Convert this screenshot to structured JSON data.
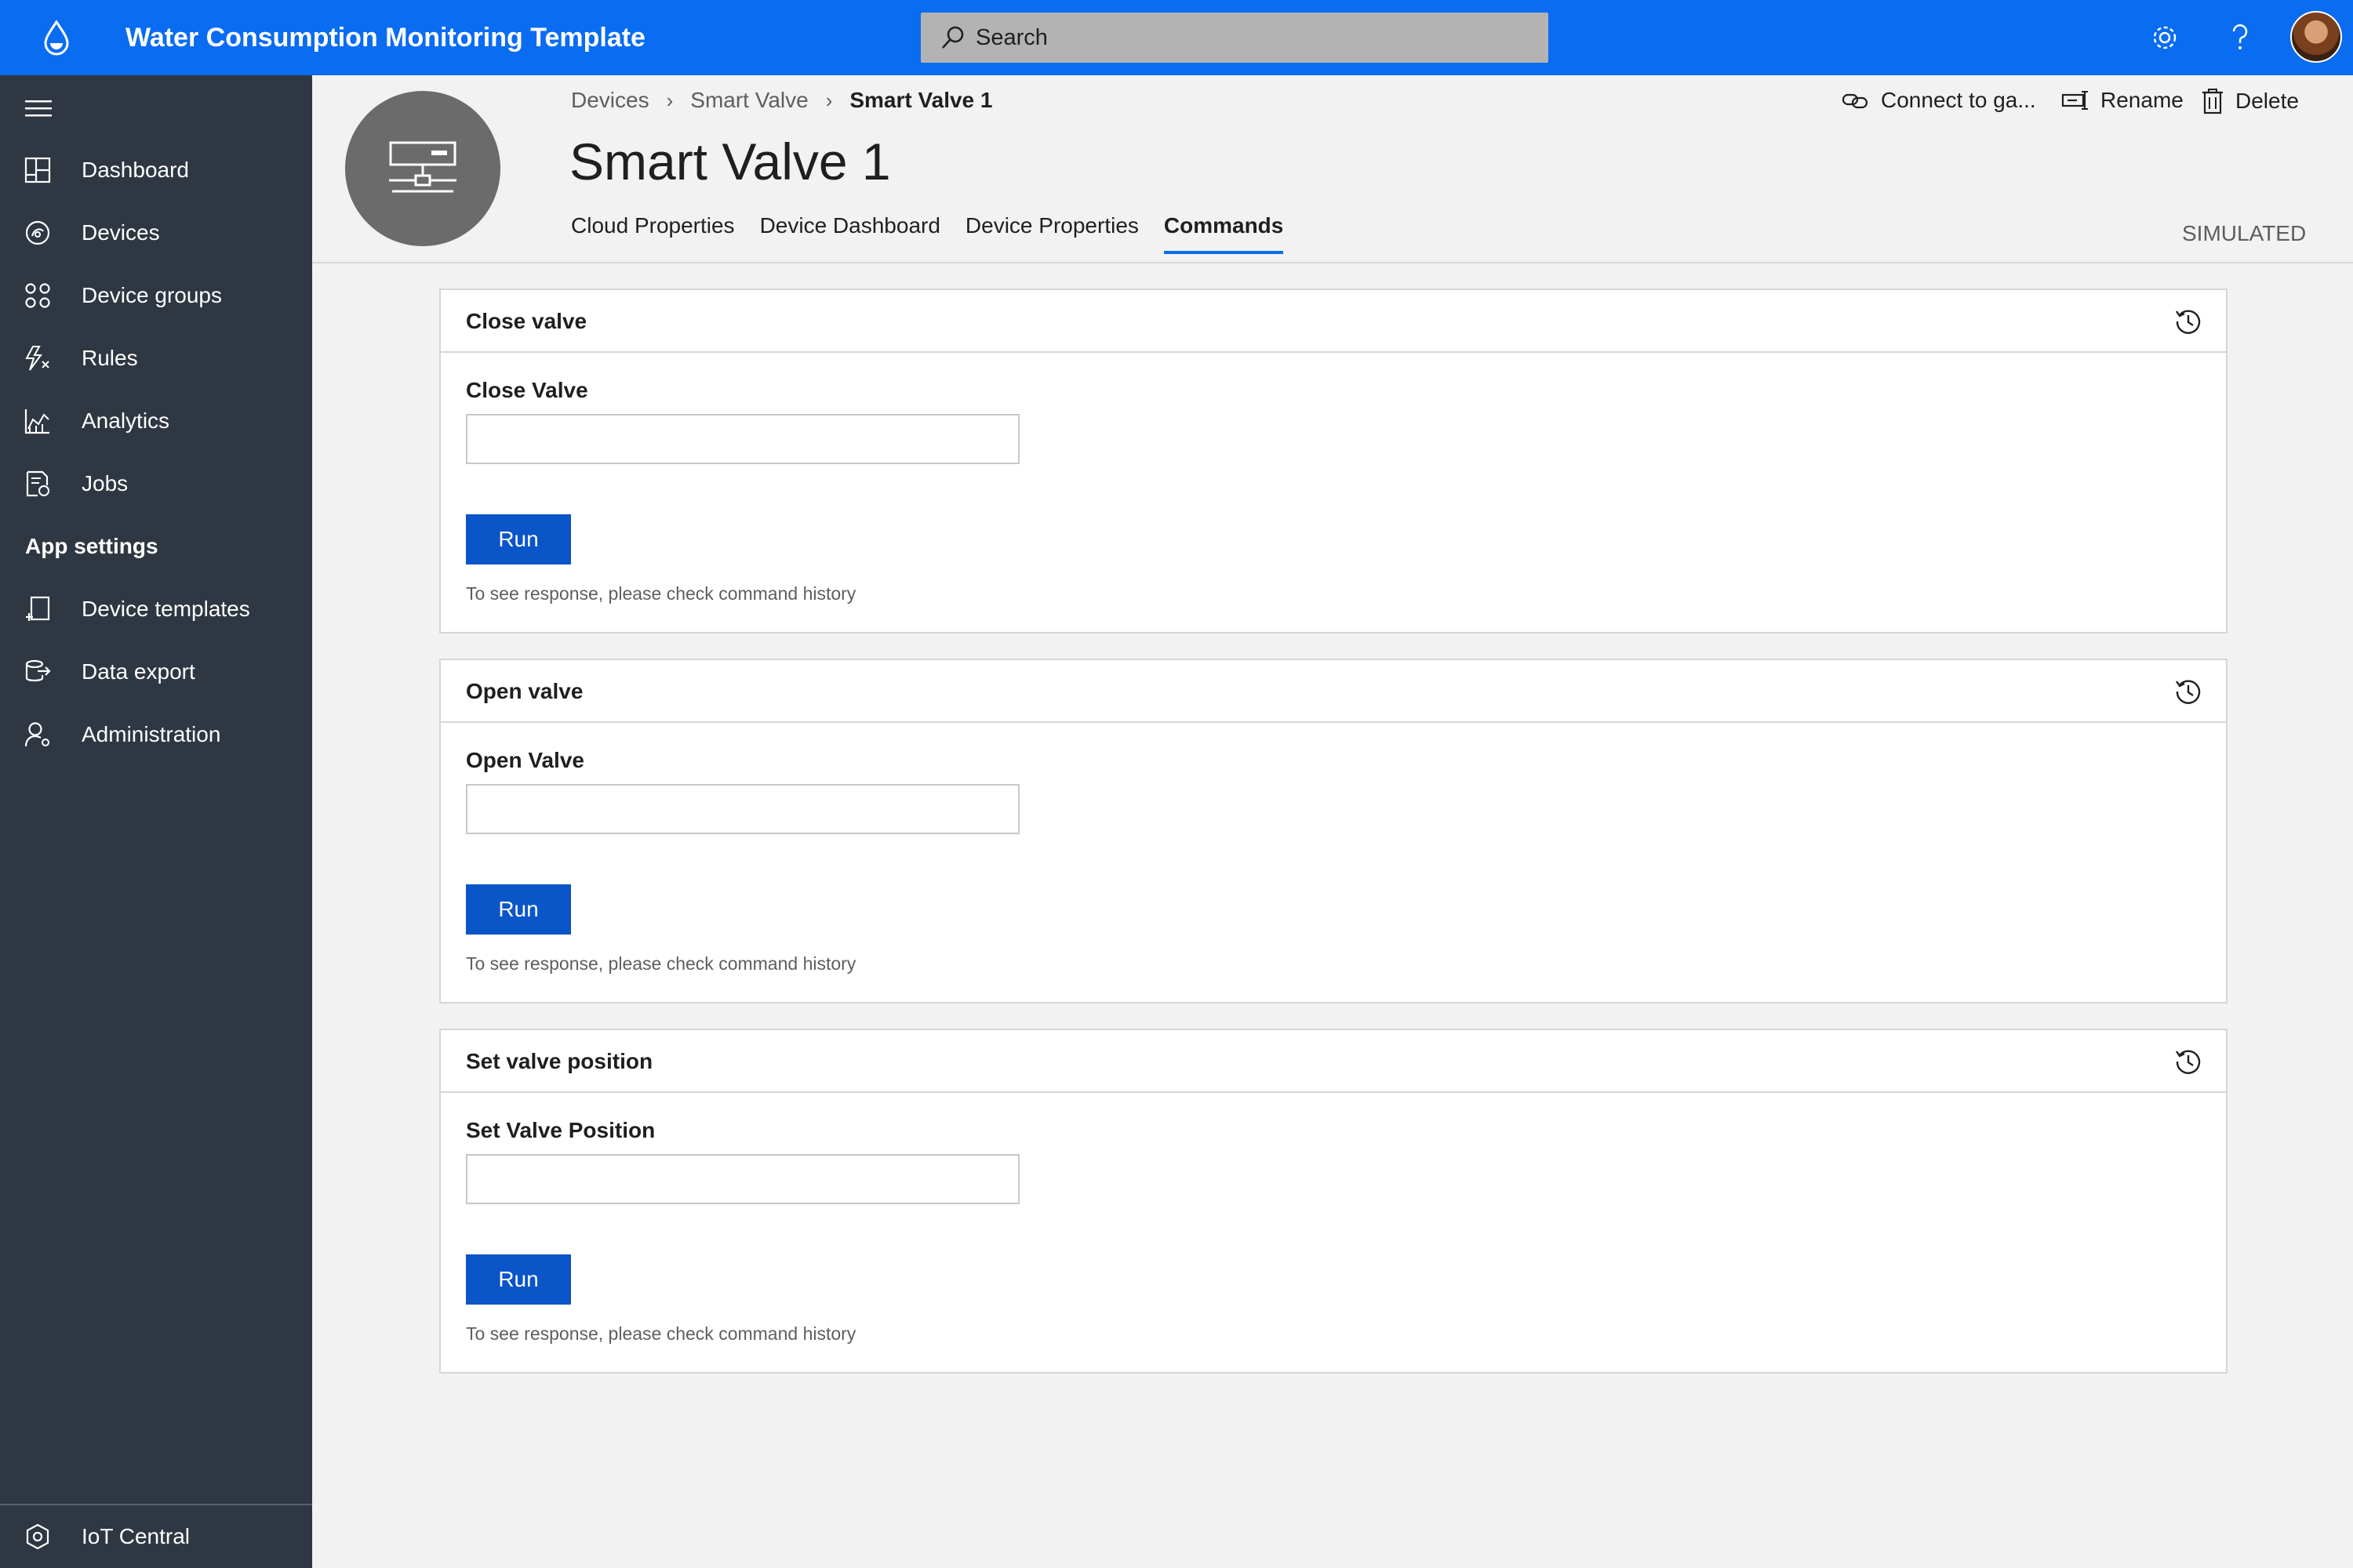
{
  "app": {
    "title": "Water Consumption Monitoring Template",
    "search_placeholder": "Search",
    "icons": {
      "logo": "water-drop-icon",
      "settings": "gear-icon",
      "help": "help-icon",
      "avatar": "user-avatar"
    },
    "accent_color": "#0a6cf1"
  },
  "sidebar": {
    "items": [
      {
        "label": "Dashboard",
        "icon": "dashboard-icon"
      },
      {
        "label": "Devices",
        "icon": "devices-icon"
      },
      {
        "label": "Device groups",
        "icon": "device-groups-icon"
      },
      {
        "label": "Rules",
        "icon": "rules-icon"
      },
      {
        "label": "Analytics",
        "icon": "analytics-icon"
      },
      {
        "label": "Jobs",
        "icon": "jobs-icon"
      }
    ],
    "section_label": "App settings",
    "settings_items": [
      {
        "label": "Device templates",
        "icon": "device-templates-icon"
      },
      {
        "label": "Data export",
        "icon": "data-export-icon"
      },
      {
        "label": "Administration",
        "icon": "administration-icon"
      }
    ],
    "bottom_label": "IoT Central"
  },
  "header": {
    "breadcrumb": [
      "Devices",
      "Smart Valve",
      "Smart Valve 1"
    ],
    "device_title": "Smart Valve 1",
    "tabs": [
      "Cloud Properties",
      "Device Dashboard",
      "Device Properties",
      "Commands"
    ],
    "active_tab": "Commands",
    "status": "SIMULATED",
    "actions": {
      "connect": "Connect to ga...",
      "rename": "Rename",
      "delete": "Delete"
    }
  },
  "commands": [
    {
      "title": "Close valve",
      "field_label": "Close Valve",
      "value": "",
      "run_label": "Run",
      "hint": "To see response, please check command history"
    },
    {
      "title": "Open valve",
      "field_label": "Open Valve",
      "value": "",
      "run_label": "Run",
      "hint": "To see response, please check command history"
    },
    {
      "title": "Set valve position",
      "field_label": "Set Valve Position",
      "value": "",
      "run_label": "Run",
      "hint": "To see response, please check command history"
    }
  ]
}
